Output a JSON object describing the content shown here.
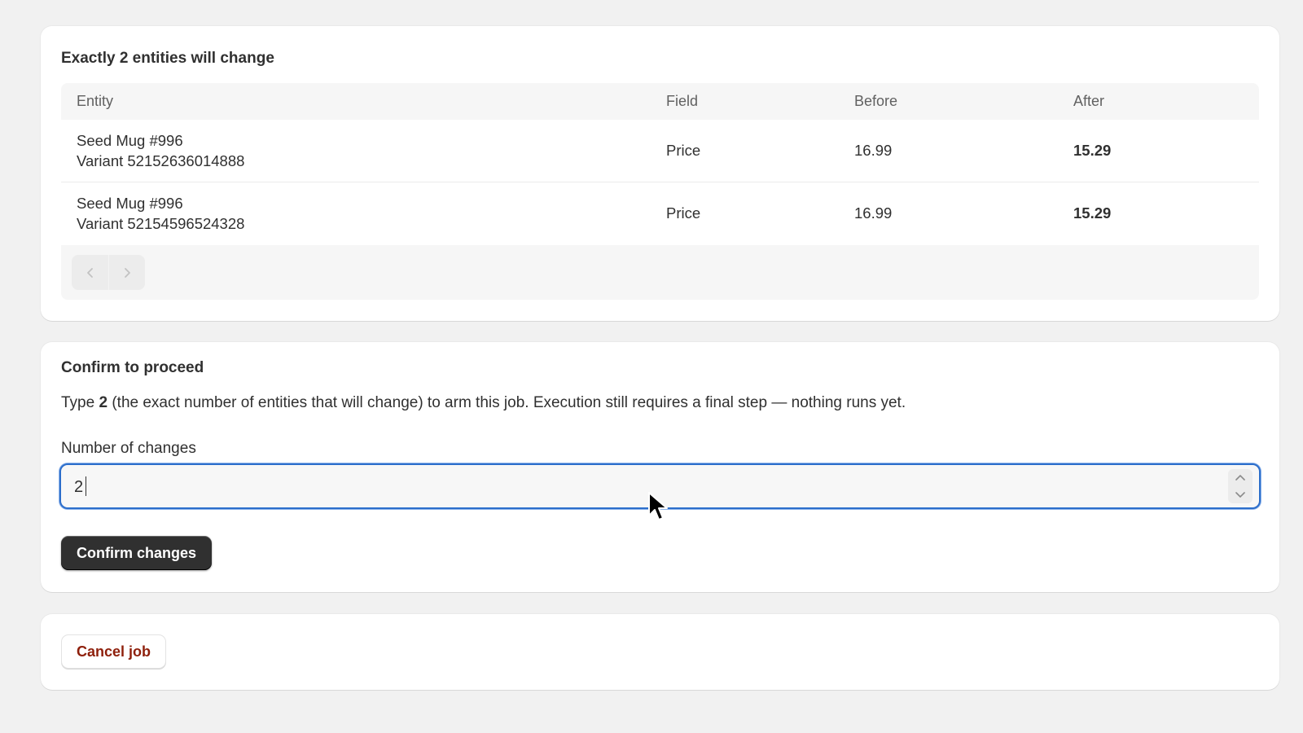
{
  "preview": {
    "title": "Exactly 2 entities will change",
    "columns": {
      "entity": "Entity",
      "field": "Field",
      "before": "Before",
      "after": "After"
    },
    "rows": [
      {
        "entity_name": "Seed Mug #996",
        "entity_variant": "Variant 52152636014888",
        "field": "Price",
        "before": "16.99",
        "after": "15.29"
      },
      {
        "entity_name": "Seed Mug #996",
        "entity_variant": "Variant 52154596524328",
        "field": "Price",
        "before": "16.99",
        "after": "15.29"
      }
    ],
    "pagination": {
      "prev_icon": "chevron-left-icon",
      "next_icon": "chevron-right-icon"
    }
  },
  "confirm": {
    "title": "Confirm to proceed",
    "desc_prefix": "Type ",
    "desc_number": "2",
    "desc_suffix": " (the exact number of entities that will change) to arm this job. Execution still requires a final step — nothing runs yet.",
    "field_label": "Number of changes",
    "input_value": "2",
    "stepper_icons": [
      "chevron-up-icon",
      "chevron-down-icon"
    ],
    "button_label": "Confirm changes"
  },
  "cancel": {
    "button_label": "Cancel job"
  },
  "colors": {
    "page_bg": "#f1f1f1",
    "card_bg": "#ffffff",
    "focus_border": "#2c6ecb",
    "primary_button": "#303030",
    "critical_text": "#8e1f0b"
  }
}
